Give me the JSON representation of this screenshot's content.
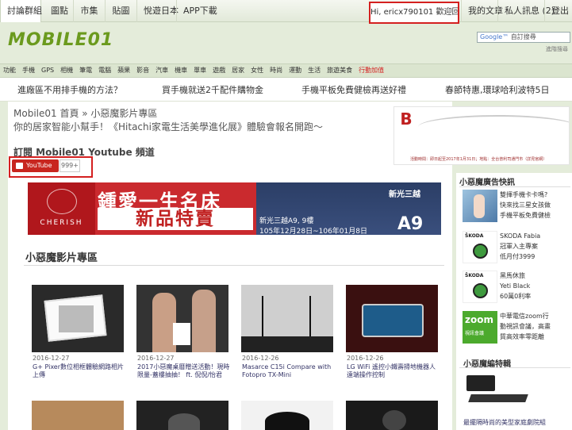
{
  "topbar": {
    "tabs": [
      "討論群組",
      "圖點",
      "市集",
      "貼圖",
      "悅遊日本",
      "APP下載"
    ],
    "greeting": "Hi, ericx790101 歡迎回來 ▾",
    "right_links": [
      "我的文章",
      "私人訊息 (2)",
      "登出"
    ]
  },
  "header": {
    "logo_text": "MOBILE01",
    "search_google": "Google™",
    "search_placeholder": "自訂搜尋",
    "advanced_search": "進階搜尋"
  },
  "catnav": [
    "功能",
    "手機",
    "GPS",
    "相機",
    "筆電",
    "電腦",
    "蘋果",
    "影音",
    "汽車",
    "機車",
    "單車",
    "遊戲",
    "居家",
    "女性",
    "時尚",
    "運動",
    "生活",
    "旅遊美食",
    "行動加值"
  ],
  "promo_links": [
    "進廠區不用排手機的方法？",
    "買手機就送2千配件購物金",
    "手機平板免費健檢再送好禮",
    "春節特惠,環球哈利波特5日"
  ],
  "page": {
    "breadcrumb": "Mobile01 首頁 » 小惡魔影片專區",
    "subtitle": "你的居家智能小幫手！《Hitachi家電生活美學進化展》體驗會報名開跑～",
    "subscribe_title": "訂閱 Mobile01 Youtube 頻道",
    "youtube_label": "YouTube",
    "youtube_count": "999+"
  },
  "top_ad": {
    "logo": "B",
    "fine_print": "活動時間：即日起至2017年1月31日；地點：全台普利司通門市（詳見官網）"
  },
  "banner_ad": {
    "brand": "CHERISH",
    "line1": "鍾愛一生名床",
    "line2": "新品特賣",
    "store": "新光三越",
    "big": "A9",
    "detail1": "新光三越A9, 9樓",
    "detail2": "105年12月28日~106年01月8日"
  },
  "section_title": "小惡魔影片專區",
  "videos": [
    {
      "date": "2016-12-27",
      "title": "G+ Pixer數位相框體驗網路相片上傳"
    },
    {
      "date": "2016-12-27",
      "title": "2017小惡魔桌曆贈送活動！現時限量-蓋樓抽抽！ ft. 倪倪/怡君"
    },
    {
      "date": "2016-12-26",
      "title": "Masarce C15i Compare with Fotopro TX-Mini"
    },
    {
      "date": "2016-12-26",
      "title": "LG WiFi 遙控小鐵壽掃地機器人遠端操作控制"
    }
  ],
  "sidebar": {
    "news_title": "小惡魔廣告快訊",
    "news": [
      {
        "lines": [
          "雙揮手機卡卡嗎?",
          "快來找三星女孩做",
          "手機平板免費健檢"
        ]
      },
      {
        "lines": [
          "SKODA Fabia",
          "冠軍入主專案",
          "低月付3999"
        ]
      },
      {
        "lines": [
          "黑馬休旅",
          "Yeti Black",
          "60萬0利率"
        ]
      },
      {
        "lines": [
          "中華電信zoom行",
          "動視訊會議，高畫",
          "質高效率零距離"
        ]
      }
    ],
    "skoda_label": "ŠKODA",
    "zoom_label": "zoom",
    "zoom_sub": "視訊會議",
    "editor_title": "小惡魔編特輯",
    "editor_item": "最擺隔時尚的美型家庭劇院組"
  },
  "colors": {
    "accent": "#6b9a1e",
    "highlight_box": "#d42020",
    "youtube": "#c8261f"
  }
}
